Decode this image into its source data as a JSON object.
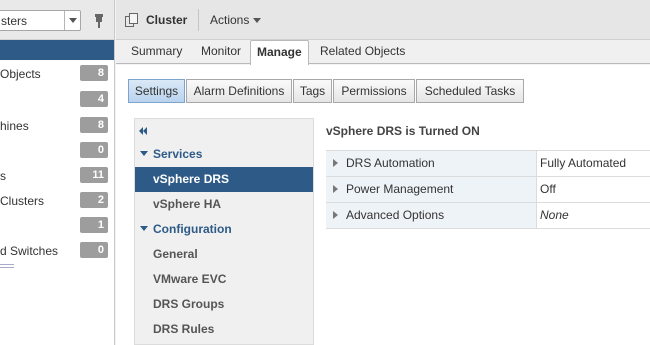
{
  "navigator": {
    "selector_text": "sters",
    "inventory": [
      {
        "label": "Objects",
        "count": "8"
      },
      {
        "label": "",
        "count": "4"
      },
      {
        "label": "hines",
        "count": "8"
      },
      {
        "label": "",
        "count": "0"
      },
      {
        "label": "s",
        "count": "11"
      },
      {
        "label": "Clusters",
        "count": "2"
      },
      {
        "label": "",
        "count": "1"
      },
      {
        "label": "d Switches",
        "count": "0"
      }
    ]
  },
  "header": {
    "title": "Cluster",
    "actions_label": "Actions"
  },
  "tabs": [
    "Summary",
    "Monitor",
    "Manage",
    "Related Objects"
  ],
  "subtabs": [
    "Settings",
    "Alarm Definitions",
    "Tags",
    "Permissions",
    "Scheduled Tasks"
  ],
  "settings_nav": {
    "groups": [
      {
        "label": "Services",
        "items": [
          "vSphere DRS",
          "vSphere HA"
        ]
      },
      {
        "label": "Configuration",
        "items": [
          "General",
          "VMware EVC",
          "DRS Groups",
          "DRS Rules"
        ]
      }
    ]
  },
  "detail": {
    "title": "vSphere DRS is Turned ON",
    "rows": [
      {
        "key": "DRS Automation",
        "value": "Fully Automated"
      },
      {
        "key": "Power Management",
        "value": "Off"
      },
      {
        "key": "Advanced Options",
        "value": "None"
      }
    ]
  },
  "colors": {
    "accent": "#2d5a87",
    "active_subtab": "#b9d3ee",
    "badge": "#9d9d9d"
  }
}
